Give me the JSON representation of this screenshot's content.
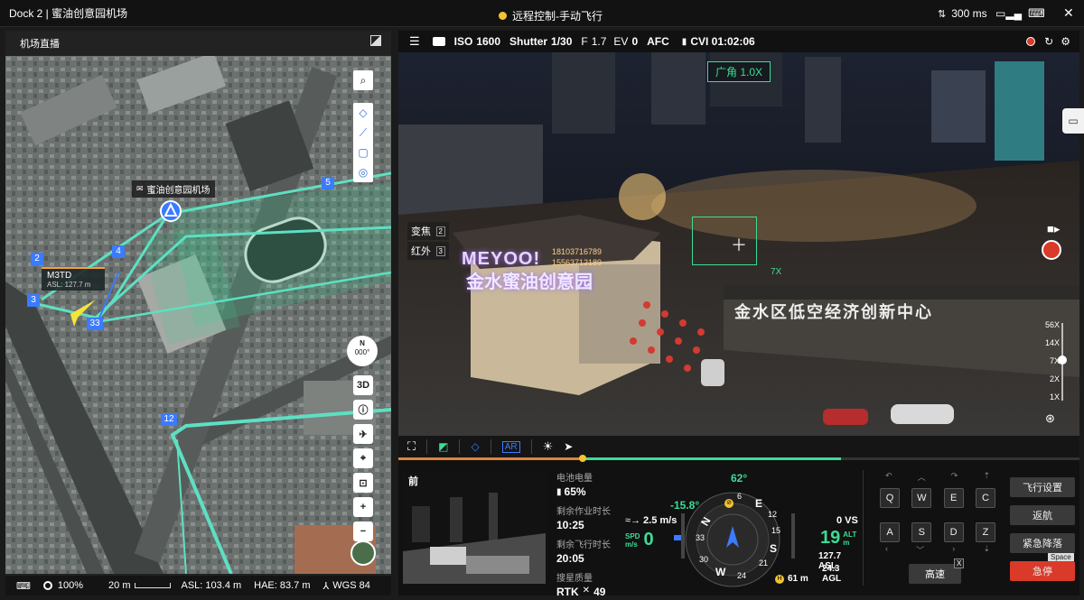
{
  "titlebar": {
    "title": "Dock 2 | 蜜油创意园机场",
    "mode": "远程控制-手动飞行",
    "latency": "300 ms"
  },
  "left": {
    "panel_title": "机场直播",
    "dock_label": "蜜油创意园机场",
    "drone_name": "M3TD",
    "drone_asl": "ASL: 127.7 m",
    "waypoints": [
      "2",
      "3",
      "4",
      "5",
      "33",
      "12"
    ],
    "btn_3d": "3D",
    "compass_heading": "000°",
    "compass_n": "N",
    "status": {
      "zoom": "100%",
      "scale": "20 m",
      "asl": "ASL: 103.4 m",
      "hae": "HAE: 83.7 m",
      "datum": "WGS 84"
    }
  },
  "camera": {
    "iso_label": "ISO",
    "iso": "1600",
    "shutter_label": "Shutter",
    "shutter": "1/30",
    "f_label": "F",
    "f": "1.7",
    "ev_label": "EV",
    "ev": "0",
    "afc": "AFC",
    "cvi": "CVI 01:02:06",
    "lens_badge": "广角 1.0X",
    "zoom_menu": [
      {
        "label": "变焦",
        "key": "2"
      },
      {
        "label": "红外",
        "key": "3"
      }
    ],
    "scene_sign1": "MEYOO!",
    "scene_sign2": "金水蜜油创意园",
    "scene_sign3": "金水区低空经济创新中心",
    "sign_phone1": "18103716789",
    "sign_phone2": "15563712189",
    "box_zoom": "7X",
    "zoom_levels": [
      "56X",
      "14X",
      "7X",
      "2X",
      "1X"
    ]
  },
  "pip": {
    "label": "前"
  },
  "telemetry": {
    "battery_label": "电池电量",
    "battery": "65%",
    "worktime_label": "剩余作业时长",
    "worktime": "10:25",
    "flytime_label": "剩余飞行时长",
    "flytime": "20:05",
    "search_label": "搜星质量",
    "rtk": "RTK",
    "rtk_count": "49"
  },
  "attitude": {
    "heading": "62°",
    "pitch": "-15.8°",
    "wind": "2.5 m/s",
    "spd_label": "SPD",
    "spd_unit": "m/s",
    "spd": "0",
    "vs": "0 VS",
    "alt": "19",
    "alt_label": "ALT",
    "alt_unit": "m",
    "asl": "127.7 ASL",
    "agl": "24.3 AGL",
    "home_dist": "61 m",
    "dial_labels": [
      "N",
      "6",
      "E",
      "12",
      "15",
      "S",
      "21",
      "24",
      "W",
      "30",
      "33"
    ]
  },
  "controls": {
    "keys_row1": [
      "Q",
      "W",
      "E",
      "C"
    ],
    "keys_row2": [
      "A",
      "S",
      "D",
      "Z"
    ],
    "speed_btn": "高速",
    "speed_key": "X",
    "flight_settings": "飞行设置",
    "return": "返航",
    "emergency_land": "紧急降落",
    "stop": "急停",
    "stop_key": "Space"
  },
  "colors": {
    "accent": "#3ddc97",
    "danger": "#d93a2a",
    "map_route": "#5de0c2",
    "warn": "#f4c430"
  }
}
